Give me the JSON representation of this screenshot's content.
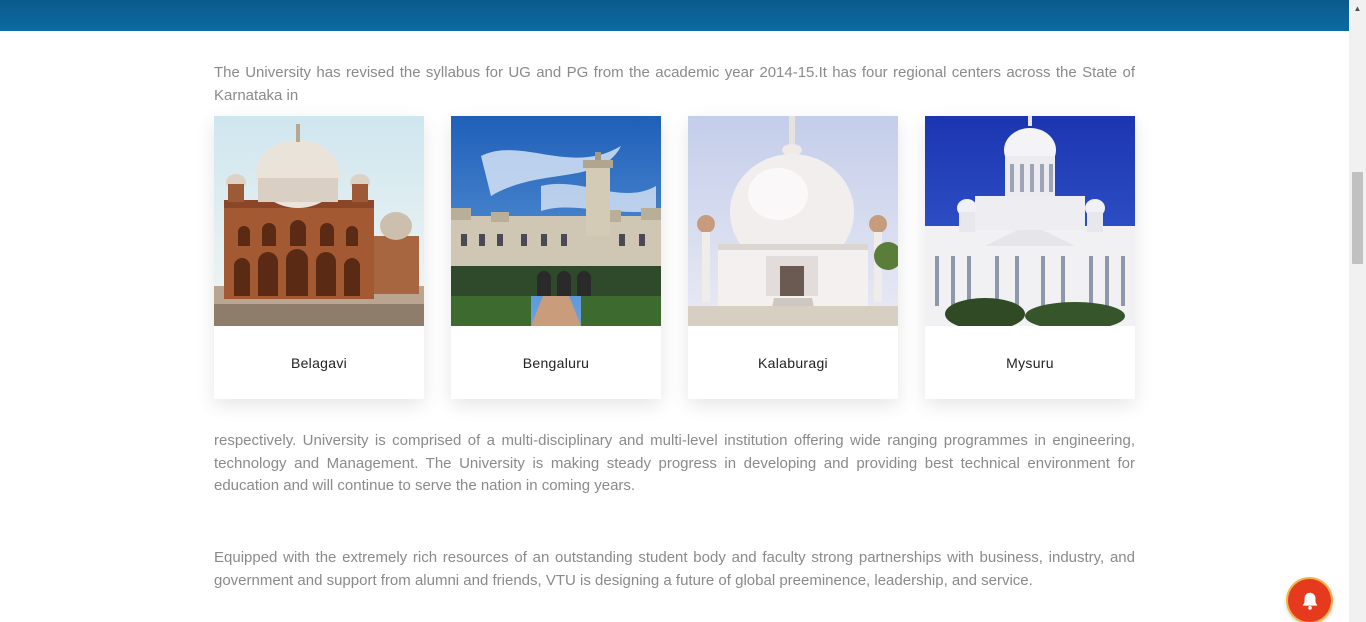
{
  "intro": {
    "text": "The University has revised the syllabus for UG and PG from the academic year 2014-15.It has four regional centers across the State of Karnataka in"
  },
  "centers": [
    {
      "name": "Belagavi",
      "image_icon": "belagavi-monument-image"
    },
    {
      "name": "Bengaluru",
      "image_icon": "bengaluru-palace-image"
    },
    {
      "name": "Kalaburagi",
      "image_icon": "kalaburagi-stupa-image"
    },
    {
      "name": "Mysuru",
      "image_icon": "mysuru-dome-building-image"
    }
  ],
  "body": {
    "paragraph1": "respectively. University is comprised of a multi-disciplinary and multi-level institution offering wide ranging programmes in engineering, technology and Management. The University is making steady progress in developing and providing best technical environment for education and will continue to serve the nation in coming years.",
    "paragraph2": "Equipped with the extremely rich resources of an outstanding student body and faculty strong partnerships with business, industry, and government and support from alumni and friends, VTU is designing a future of global preeminence, leadership, and service."
  },
  "colors": {
    "topbar": "#0c6aa3",
    "notification": "#e53a1e"
  },
  "widgets": {
    "notification_icon": "bell-icon",
    "scroll_icon": "scroll-up-arrow-icon"
  }
}
